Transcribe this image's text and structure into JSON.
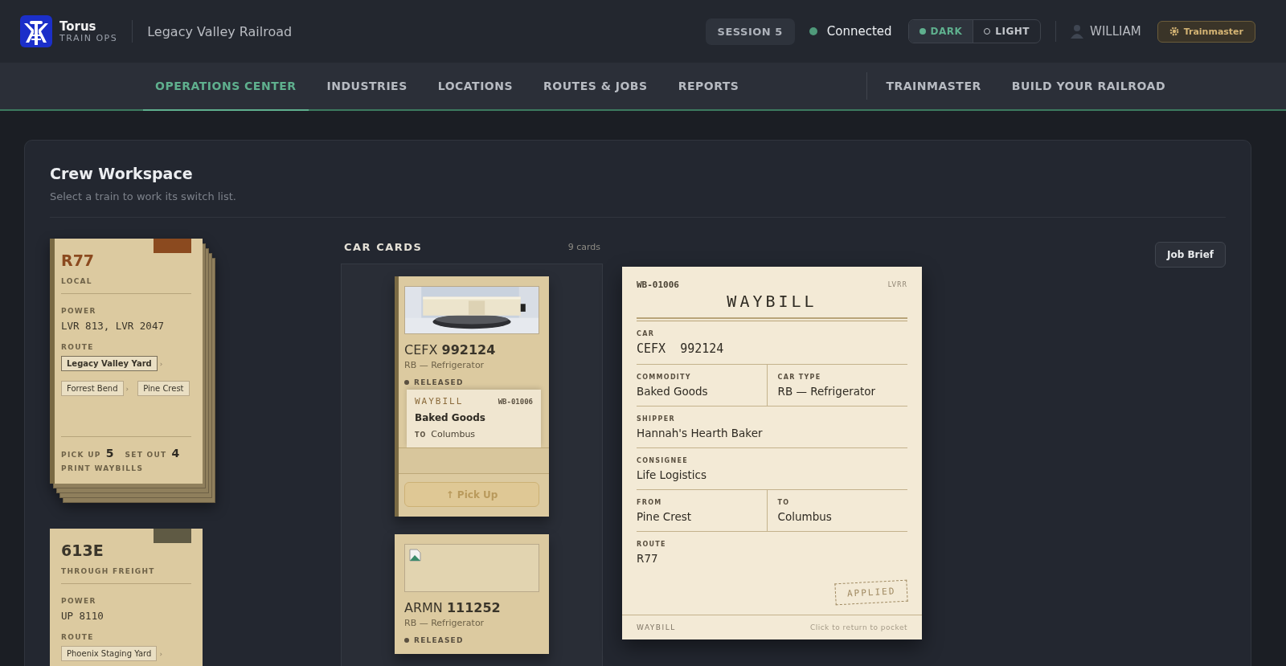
{
  "header": {
    "brand": {
      "name": "Torus",
      "sub": "TRAIN OPS"
    },
    "railroad": "Legacy Valley Railroad",
    "session": "SESSION 5",
    "connection": {
      "label": "Connected",
      "connected": true
    },
    "theme": [
      {
        "label": "DARK",
        "selected": true
      },
      {
        "label": "LIGHT",
        "selected": false
      }
    ],
    "user": "WILLIAM",
    "role_button": "Trainmaster"
  },
  "nav": [
    {
      "label": "OPERATIONS CENTER",
      "selected": true
    },
    {
      "label": "INDUSTRIES",
      "selected": false
    },
    {
      "label": "LOCATIONS",
      "selected": false
    },
    {
      "label": "ROUTES & JOBS",
      "selected": false
    },
    {
      "label": "REPORTS",
      "selected": false
    }
  ],
  "nav_secondary": [
    {
      "label": "TRAINMASTER",
      "selected": false
    },
    {
      "label": "BUILD YOUR RAILROAD",
      "selected": false
    }
  ],
  "workspace": {
    "title": "Crew Workspace",
    "subtitle": "Select a train to work its switch list.",
    "job_brief": "Job Brief"
  },
  "trains": [
    {
      "id": "R77",
      "type": "LOCAL",
      "color": "#8b4a1f",
      "selected": true,
      "power_label": "POWER",
      "power": "LVR 813, LVR 2047",
      "route_label": "ROUTE",
      "route": [
        {
          "name": "Legacy Valley Yard",
          "current": true,
          "separator": "›"
        },
        {
          "name": "Forrest Bend",
          "current": false,
          "separator": "›"
        },
        {
          "name": "Pine Crest",
          "current": false
        }
      ],
      "pick_up_label": "PICK UP",
      "pick_up": "5",
      "set_out_label": "SET OUT",
      "set_out": "4",
      "print_label": "PRINT WAYBILLS"
    },
    {
      "id": "613E",
      "type": "THROUGH FREIGHT",
      "color": "#5f5a44",
      "selected": false,
      "power_label": "POWER",
      "power": "UP 8110",
      "route_label": "ROUTE",
      "route": [
        {
          "name": "Phoenix Staging Yard",
          "current": false,
          "separator": "›"
        }
      ]
    }
  ],
  "car_cards": {
    "title": "CAR CARDS",
    "count": "9 cards",
    "cards": [
      {
        "reporting": "CEFX",
        "number": "992124",
        "type": "RB — Refrigerator",
        "status": "RELEASED",
        "waybill": {
          "title": "WAYBILL",
          "id": "WB-01006",
          "commodity": "Baked Goods",
          "to_label": "TO",
          "to": "Columbus"
        },
        "action": "↑ Pick Up"
      },
      {
        "reporting": "ARMN",
        "number": "111252",
        "type": "RB — Refrigerator",
        "status": "RELEASED",
        "kind": "no-photo"
      }
    ]
  },
  "waybill": {
    "id": "WB-01006",
    "railroad": "LVRR",
    "title": "WAYBILL",
    "rows": [
      [
        {
          "label": "CAR",
          "value": "CEFX  992124",
          "kind": "mono"
        }
      ],
      [
        {
          "label": "COMMODITY",
          "value": "Baked Goods",
          "kind": "text"
        },
        {
          "label": "CAR TYPE",
          "value": "RB — Refrigerator",
          "kind": "text"
        }
      ],
      [
        {
          "label": "SHIPPER",
          "value": "Hannah's Hearth Baker",
          "kind": "text"
        }
      ],
      [
        {
          "label": "CONSIGNEE",
          "value": "Life Logistics",
          "kind": "text"
        }
      ],
      [
        {
          "label": "FROM",
          "value": "Pine Crest",
          "kind": "text"
        },
        {
          "label": "TO",
          "value": "Columbus",
          "kind": "text"
        }
      ],
      [
        {
          "label": "ROUTE",
          "value": "R77",
          "kind": "text"
        }
      ]
    ],
    "stamp": "APPLIED",
    "footer_left": "WAYBILL",
    "footer_right": "Click to return to pocket"
  }
}
